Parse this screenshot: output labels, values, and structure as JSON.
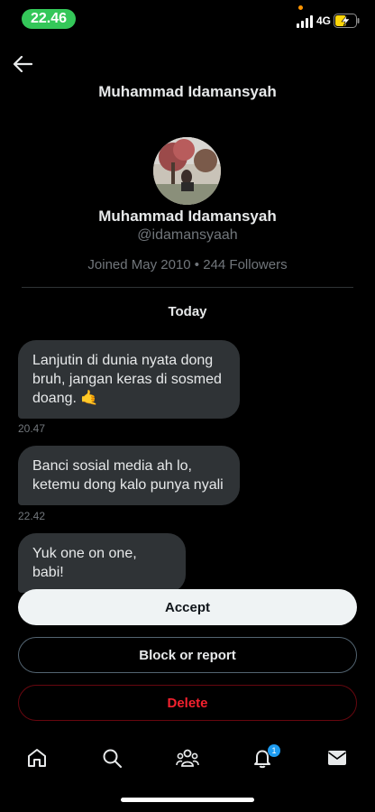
{
  "status_bar": {
    "time": "22.46",
    "network": "4G"
  },
  "header": {
    "title": "Muhammad Idamansyah"
  },
  "profile": {
    "name": "Muhammad Idamansyah",
    "handle": "@idamansyaah",
    "meta": "Joined May 2010 • 244 Followers"
  },
  "conversation": {
    "day_label": "Today",
    "messages": [
      {
        "text": "Lanjutin di dunia nyata dong bruh, jangan keras di sosmed doang. 🤙",
        "time": "20.47"
      },
      {
        "text": "Banci sosial media ah lo, ketemu dong kalo punya nyali",
        "time": "22.42"
      },
      {
        "text": "Yuk one on one, babi!",
        "time": ""
      }
    ]
  },
  "actions": {
    "accept_label": "Accept",
    "block_label": "Block or report",
    "delete_label": "Delete"
  },
  "tabbar": {
    "items": [
      "home-icon",
      "search-icon",
      "communities-icon",
      "notifications-icon",
      "messages-icon"
    ],
    "notifications_badge": "1"
  },
  "colors": {
    "accent": "#1d9bf0",
    "danger": "#f4212e",
    "status_green": "#34c759"
  }
}
